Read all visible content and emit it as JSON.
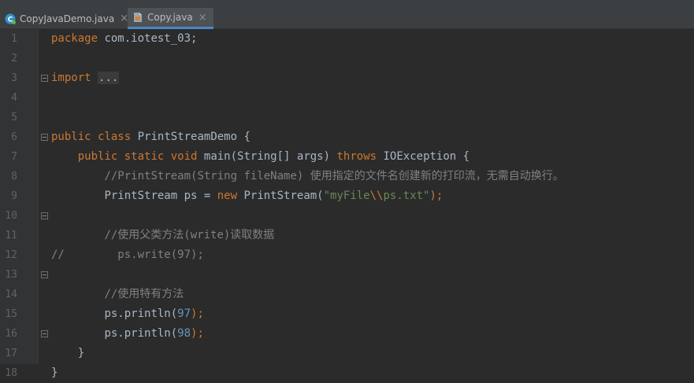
{
  "tabs": [
    {
      "label": "CopyJavaDemo.java",
      "active": false,
      "icon": "java-class-icon"
    },
    {
      "label": "Copy.java",
      "active": true,
      "icon": "java-file-icon"
    }
  ],
  "tab_close_glyph": "×",
  "line_numbers": [
    "1",
    "2",
    "3",
    "4",
    "5",
    "6",
    "7",
    "8",
    "9",
    "10",
    "11",
    "12",
    "13",
    "14",
    "15",
    "16",
    "17",
    "18"
  ],
  "code": {
    "l1": {
      "kw": "package",
      "rest": " com.iotest_03;"
    },
    "l3": {
      "kw": "import",
      "space": " ",
      "folded": "..."
    },
    "l6": {
      "kw1": "public",
      "kw2": "class",
      "rest": " PrintStreamDemo {"
    },
    "l7": {
      "indent": "    ",
      "kw1": "public",
      "kw2": "static",
      "kw3": "void",
      "mid": " main(String[] args) ",
      "kw4": "throws",
      "rest": " IOException {"
    },
    "l8": {
      "indent": "        ",
      "comment": "//PrintStream(String fileName) 使用指定的文件名创建新的打印流，无需自动换行。"
    },
    "l9": {
      "indent": "        ",
      "pre": "PrintStream ps = ",
      "kw": "new",
      "mid": " PrintStream(",
      "str1": "\"myFile",
      "esc": "\\\\",
      "str2": "ps.txt\"",
      "rest": ");"
    },
    "l11": {
      "indent": "        ",
      "comment": "//使用父类方法(write)读取数据"
    },
    "l12": {
      "comment": "//        ps.write(97);"
    },
    "l14": {
      "indent": "        ",
      "comment": "//使用特有方法"
    },
    "l15": {
      "indent": "        ",
      "pre": "ps.println(",
      "num": "97",
      "rest": ");"
    },
    "l16": {
      "indent": "        ",
      "pre": "ps.println(",
      "num": "98",
      "rest": ");"
    },
    "l17": {
      "indent": "    ",
      "rest": "}"
    },
    "l18": {
      "rest": "}"
    }
  },
  "colors": {
    "background": "#2b2b2b",
    "gutter": "#313335",
    "keyword": "#cc7832",
    "comment": "#808080",
    "string": "#6a8759",
    "number": "#6897bb",
    "identifier": "#a9b7c6",
    "tab_accent": "#4a88c7"
  }
}
